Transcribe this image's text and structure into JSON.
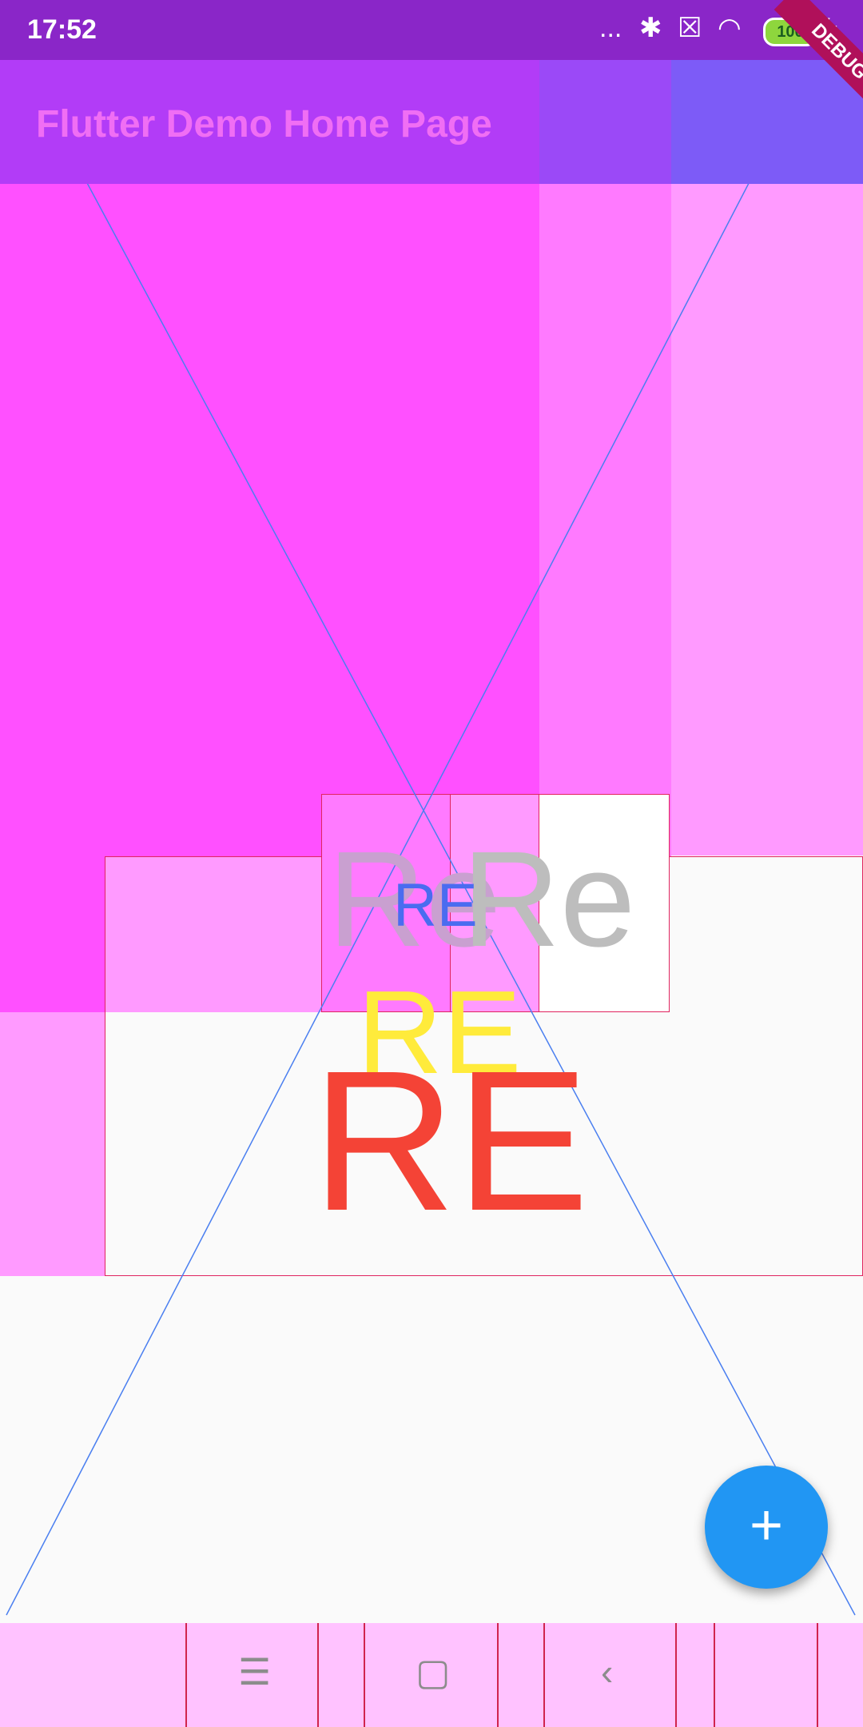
{
  "status_bar": {
    "time": "17:52",
    "dots": "...",
    "bluetooth_icon": "bluetooth-icon",
    "sim_icon": "no-sim-icon",
    "wifi_icon": "wifi-icon",
    "battery_level": "100",
    "charging_icon": "charging-icon"
  },
  "app_bar": {
    "title": "Flutter Demo Home Page"
  },
  "debug_banner": "DEBUG",
  "texts": {
    "grey_left": "Re",
    "grey_right": "Re",
    "blue": "RE",
    "yellow": "RE",
    "red": "RE"
  },
  "colors": {
    "grey": "#bdbdbd",
    "blue": "#4a6cf0",
    "yellow": "#ffeb3b",
    "red": "#f44336",
    "fab": "#2196f3"
  },
  "fab": {
    "label": "+"
  },
  "nav_bar": {
    "menu": "☰",
    "home": "▢",
    "back": "‹"
  }
}
